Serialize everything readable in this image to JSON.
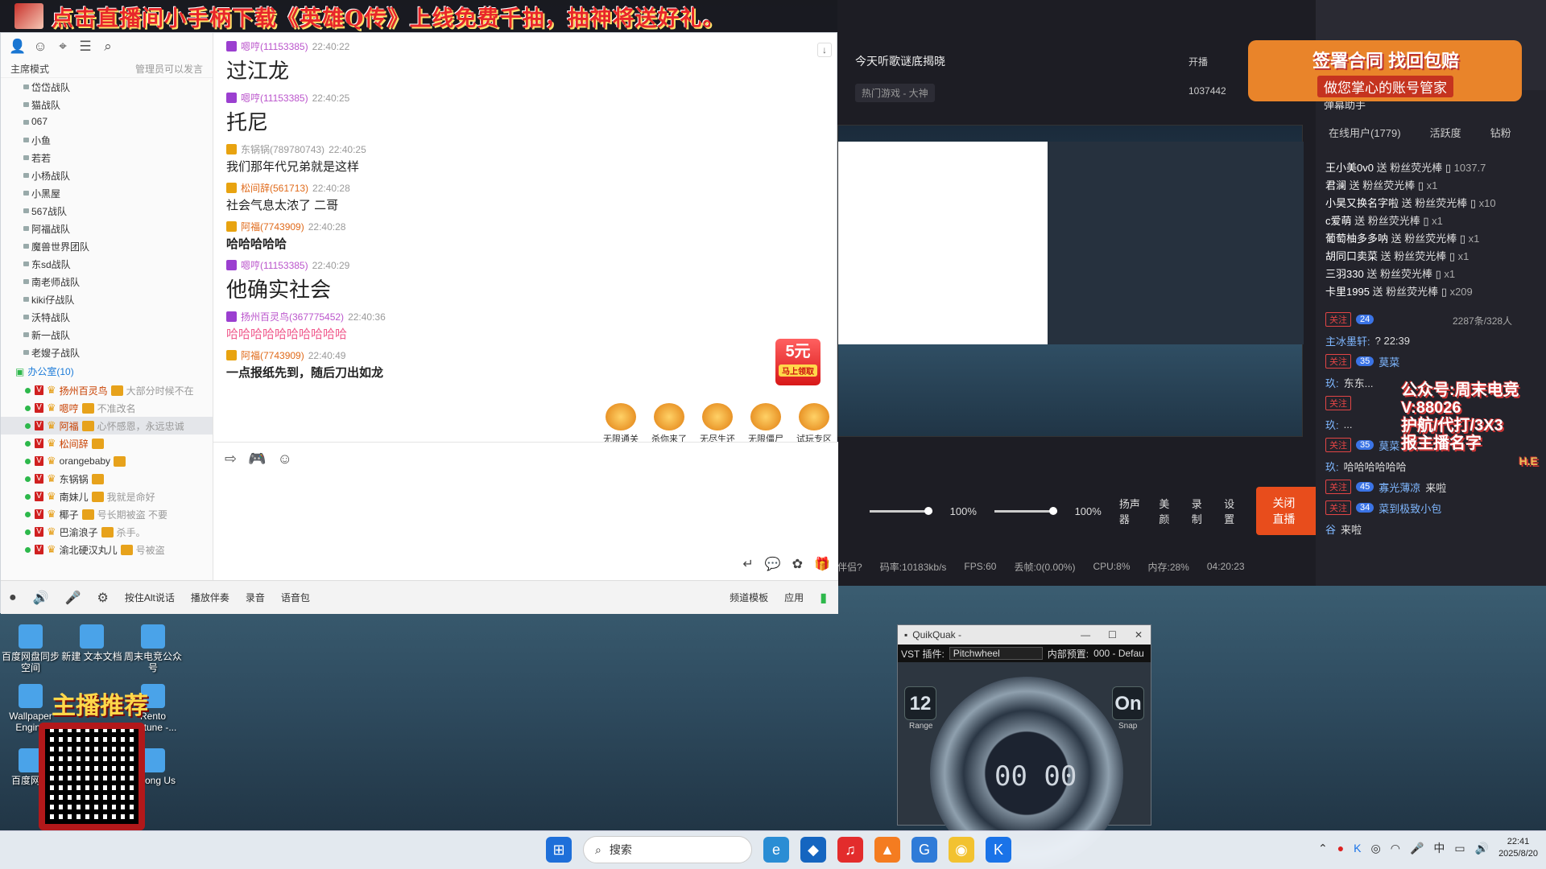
{
  "banner": {
    "text": "点击直播间小手柄下载《英雄Q传》上线免费千抽，抽神将送好礼。"
  },
  "yy": {
    "mode_label": "主席模式",
    "admin_note": "管理员可以发言",
    "groups": [
      "岱岱战队",
      "猫战队",
      "067",
      "小鱼",
      "若若",
      "小杨战队",
      "小黑屋",
      "567战队",
      "阿福战队",
      "魔兽世界团队",
      "东sd战队",
      "南老师战队",
      "kiki仔战队",
      "沃特战队",
      "新一战队",
      "老嫂子战队"
    ],
    "office": {
      "label": "办公室",
      "count": "(10)"
    },
    "members": [
      {
        "name": "扬州百灵鸟",
        "note": "大部分时候不在",
        "sel": false
      },
      {
        "name": "嗯哼",
        "note": "不准改名",
        "sel": false
      },
      {
        "name": "阿福",
        "note": "心怀感恩，永远忠诚",
        "sel": true
      },
      {
        "name": "松间辞",
        "note": "",
        "sel": false
      },
      {
        "name": "orangebaby",
        "note": "",
        "sel": false
      },
      {
        "name": "东锅锅",
        "note": "",
        "sel": false
      },
      {
        "name": "南妹儿",
        "note": "我就是命好",
        "sel": false
      },
      {
        "name": "椰子",
        "note": "号长期被盗 不要",
        "sel": false
      },
      {
        "name": "巴渝浪子",
        "note": "杀手。",
        "sel": false
      },
      {
        "name": "渝北硬汉丸儿",
        "note": "号被盗",
        "sel": false
      }
    ],
    "chat": [
      {
        "user": "嗯哼(11153385)",
        "time": "22:40:22",
        "text": "过江龙",
        "style": "big",
        "nc": ""
      },
      {
        "user": "嗯哼(11153385)",
        "time": "22:40:25",
        "text": "托尼",
        "style": "big",
        "nc": ""
      },
      {
        "user": "东锅锅(789780743)",
        "time": "22:40:25",
        "text": "我们那年代兄弟就是这样",
        "style": "mid",
        "nc": "g"
      },
      {
        "user": "松间辞(561713)",
        "time": "22:40:28",
        "text": "社会气息太浓了 二哥",
        "style": "mid",
        "nc": "o"
      },
      {
        "user": "阿福(7743909)",
        "time": "22:40:28",
        "text": "哈哈哈哈哈",
        "style": "bold",
        "nc": "o"
      },
      {
        "user": "嗯哼(11153385)",
        "time": "22:40:29",
        "text": "他确实社会",
        "style": "big",
        "nc": ""
      },
      {
        "user": "扬州百灵鸟(367775452)",
        "time": "22:40:36",
        "text": "哈哈哈哈哈哈哈哈哈哈",
        "style": "pink",
        "nc": ""
      },
      {
        "user": "阿福(7743909)",
        "time": "22:40:49",
        "text": "一点报纸先到，随后刀出如龙",
        "style": "bold",
        "nc": "o"
      }
    ],
    "promo": {
      "amount": "5元",
      "sub": "马上领取"
    },
    "games": [
      "无限通关",
      "杀你来了",
      "无尽生还",
      "无限僵尸",
      "试玩专区"
    ],
    "footer": {
      "alt_talk": "按住Alt说话",
      "accompany": "播放伴奏",
      "record": "录音",
      "voice_pack": "语音包",
      "channel_tpl": "频道模板",
      "apps": "应用"
    }
  },
  "studio": {
    "stream_title": "今天听歌谜底揭晓",
    "category": "热门游戏 - 大神",
    "start_label": "开播",
    "heat": "1037442",
    "vol1": "100%",
    "vol2": "100%",
    "controls": [
      "扬声器",
      "美颜",
      "录制",
      "设置"
    ],
    "close_live": "关闭直播",
    "stats": [
      "伴侣?",
      "码率:10183kb/s",
      "FPS:60",
      "丢帧:0(0.00%)",
      "CPU:8%",
      "内存:28%",
      "04:20:23"
    ]
  },
  "right": {
    "assistant": "弹幕助手",
    "tabs": [
      "在线用户(1779)",
      "活跃度",
      "钻粉"
    ],
    "promo": {
      "t1": "签署合同 找回包赔",
      "t2": "做您掌心的账号管家"
    },
    "gifts": [
      {
        "w": "王小美0v0",
        "t": "送 粉丝荧光棒",
        "c": "1037.7"
      },
      {
        "w": "君澜",
        "t": "送 粉丝荧光棒",
        "c": "x1"
      },
      {
        "w": "小昊又换名字啦",
        "t": "送 粉丝荧光棒",
        "c": "x10"
      },
      {
        "w": "c爱萌",
        "t": "送 粉丝荧光棒",
        "c": "x1"
      },
      {
        "w": "葡萄柚多多呐",
        "t": "送 粉丝荧光棒",
        "c": "x1"
      },
      {
        "w": "胡同口卖菜",
        "t": "送 粉丝荧光棒",
        "c": "x1"
      },
      {
        "w": "三羽330",
        "t": "送 粉丝荧光棒",
        "c": "x1"
      },
      {
        "w": "卡里1995",
        "t": "送 粉丝荧光棒",
        "c": "x209"
      }
    ],
    "fans": "2287条/328人",
    "lines": [
      {
        "tag": "关注",
        "lvl": "24",
        "name": "",
        "text": ""
      },
      {
        "tag": "",
        "lvl": "",
        "name": "主冰墨轩:",
        "text": "?  22:39"
      },
      {
        "tag": "关注",
        "lvl": "35",
        "name": "莫菜",
        "text": ""
      },
      {
        "tag": "",
        "lvl": "",
        "name": "玖:",
        "text": "东东..."
      },
      {
        "tag": "关注",
        "lvl": "",
        "name": "",
        "text": ""
      },
      {
        "tag": "",
        "lvl": "",
        "name": "玖:",
        "text": "..."
      },
      {
        "tag": "关注",
        "lvl": "35",
        "name": "莫菜",
        "text": ""
      },
      {
        "tag": "",
        "lvl": "",
        "name": "玖:",
        "text": "哈哈哈哈哈哈"
      },
      {
        "tag": "关注",
        "lvl": "45",
        "name": "寡光薄凉",
        "text": "来啦"
      },
      {
        "tag": "关注",
        "lvl": "34",
        "name": "菜到极致小包",
        "text": ""
      },
      {
        "tag": "",
        "lvl": "",
        "name": "谷",
        "text": "来啦"
      }
    ],
    "overlay": [
      "公众号:周末电竞",
      "V:88026",
      "护航/代打/3X3",
      "报主播名字"
    ],
    "brand": "H.E"
  },
  "qq": {
    "title": "QuikQuak -",
    "plugin_label": "VST 插件:",
    "plugin": "Pitchwheel",
    "preset_label": "内部预置:",
    "preset": "000 - Defau",
    "range": "12",
    "range_label": "Range",
    "snap": "On",
    "snap_label": "Snap",
    "time": "00 00"
  },
  "desktop": {
    "icons": [
      "百度网盘同步空间",
      "新建 文本文档",
      "周末电竞公众号",
      "Wallpaper Engine",
      "Rento Fortune -...",
      "百度网盘",
      "Among Us"
    ],
    "qr_title": "主播推荐"
  },
  "taskbar": {
    "search": "搜索",
    "time": "22:41",
    "date": "2025/8/20",
    "ime": "中"
  }
}
